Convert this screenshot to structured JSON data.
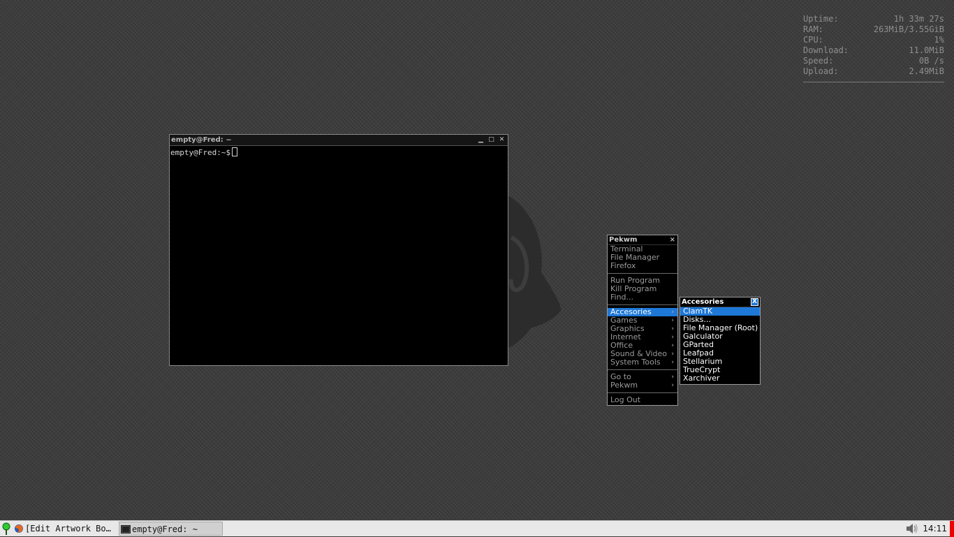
{
  "conky": {
    "rows": [
      {
        "label": "Uptime:",
        "value": "1h 33m 27s"
      },
      {
        "label": "RAM:",
        "value": "263MiB/3.55GiB"
      },
      {
        "label": "CPU:",
        "value": "1%"
      },
      {
        "label": "Download:",
        "value": "11.0MiB"
      },
      {
        "label": "Speed:",
        "value": "0B  /s"
      },
      {
        "label": "Upload:",
        "value": "2.49MiB"
      }
    ]
  },
  "terminal": {
    "title": "empty@Fred: ~",
    "prompt": "empty@Fred:~$",
    "buttons": {
      "minimize": "▁",
      "maximize": "□",
      "close": "✕"
    }
  },
  "main_menu": {
    "title": "Pekwm",
    "close": "×",
    "group1": [
      "Terminal",
      "File Manager",
      "Firefox"
    ],
    "group2": [
      "Run Program",
      "Kill Program",
      "Find..."
    ],
    "group3": [
      "Accesories",
      "Games",
      "Graphics",
      "Internet",
      "Office",
      "Sound & Video",
      "System Tools"
    ],
    "group4": [
      "Go to",
      "Pekwm"
    ],
    "group5": [
      "Log Out"
    ],
    "submenu_arrow": "›"
  },
  "sub_menu": {
    "title": "Accesories",
    "close": "X",
    "items": [
      "ClamTK",
      "Disks...",
      "File Manager (Root)",
      "Galculator",
      "GParted",
      "Leafpad",
      "Stellarium",
      "TrueCrypt",
      "Xarchiver"
    ]
  },
  "taskbar": {
    "task1": "[Edit  Artwork Bo…",
    "task2": "empty@Fred: ~",
    "clock": "14:11"
  },
  "colors": {
    "menu_highlight": "#1e78d8",
    "background": "#3a3a3a",
    "taskbar": "#e8e8e8"
  }
}
